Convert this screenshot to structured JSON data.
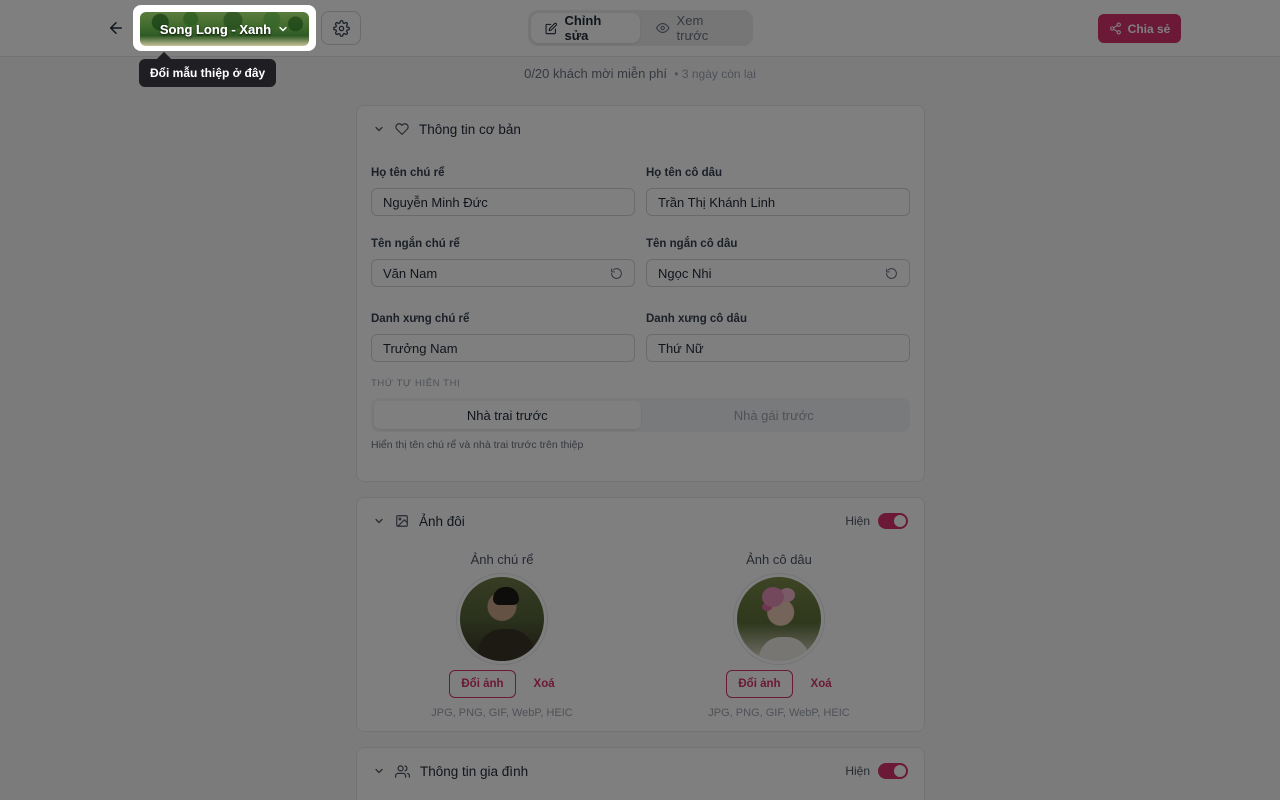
{
  "topbar": {
    "template_name": "Song Long - Xanh",
    "modes": [
      {
        "label": "Chỉnh sửa",
        "active": true
      },
      {
        "label": "Xem trước",
        "active": false
      }
    ],
    "share_label": "Chia sẻ"
  },
  "guest_info": {
    "count": "0/20",
    "text": "khách mời miễn phí",
    "remaining": "• 3 ngày còn lại"
  },
  "basic_info": {
    "title": "Thông tin cơ bản",
    "groom_name_label": "Họ tên chú rể",
    "groom_name": "Nguyễn Minh Đức",
    "bride_name_label": "Họ tên cô dâu",
    "bride_name": "Trần Thị Khánh Linh",
    "groom_short_label": "Tên ngắn chú rể",
    "groom_short": "Văn Nam",
    "bride_short_label": "Tên ngắn cô dâu",
    "bride_short": "Ngọc Nhi",
    "groom_title_label": "Danh xưng chú rể",
    "groom_title": "Trưởng Nam",
    "bride_title_label": "Danh xưng cô dâu",
    "bride_title": "Thứ Nữ",
    "order_caption": "THỨ TỰ HIỂN THỊ",
    "order_options": [
      "Nhà trai trước",
      "Nhà gái trước"
    ],
    "order_hint": "Hiển thị tên chú rể và nhà trai trước trên thiệp"
  },
  "couple_photos": {
    "title": "Ảnh đôi",
    "toggle_label": "Hiện",
    "toggle_on": true,
    "groom_label": "Ảnh chú rể",
    "bride_label": "Ảnh cô dâu",
    "change_label": "Đổi ảnh",
    "delete_label": "Xoá",
    "formats": "JPG, PNG, GIF, WebP, HEIC"
  },
  "family_info": {
    "title": "Thông tin gia đình",
    "toggle_label": "Hiện",
    "toggle_on": true
  },
  "tooltip": {
    "text": "Đổi mẫu thiệp ở đây"
  },
  "colors": {
    "accent": "#d6336c",
    "overlay": "rgba(0,0,0,0.5)"
  }
}
